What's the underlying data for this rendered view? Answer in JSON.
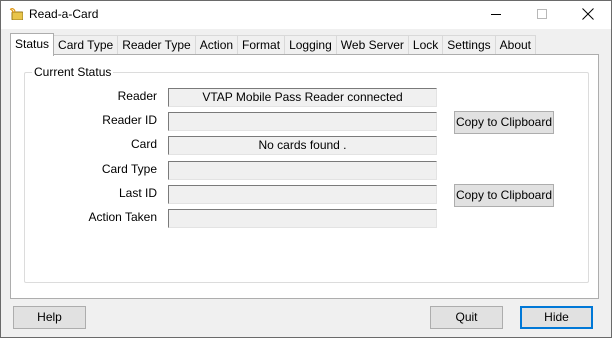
{
  "window": {
    "title": "Read-a-Card"
  },
  "tabs": [
    {
      "label": "Status",
      "active": true
    },
    {
      "label": "Card Type"
    },
    {
      "label": "Reader Type"
    },
    {
      "label": "Action"
    },
    {
      "label": "Format"
    },
    {
      "label": "Logging"
    },
    {
      "label": "Web Server"
    },
    {
      "label": "Lock"
    },
    {
      "label": "Settings"
    },
    {
      "label": "About"
    }
  ],
  "status": {
    "group_title": "Current Status",
    "fields": {
      "reader": {
        "label": "Reader",
        "value": "VTAP Mobile Pass Reader connected"
      },
      "reader_id": {
        "label": "Reader ID",
        "value": ""
      },
      "card": {
        "label": "Card",
        "value": "No cards found ."
      },
      "card_type": {
        "label": "Card Type",
        "value": ""
      },
      "last_id": {
        "label": "Last ID",
        "value": ""
      },
      "action_taken": {
        "label": "Action Taken",
        "value": ""
      }
    },
    "copy_reader_id_label": "Copy to Clipboard",
    "copy_last_id_label": "Copy to Clipboard"
  },
  "buttons": {
    "help": "Help",
    "quit": "Quit",
    "hide": "Hide"
  },
  "icons": {
    "app": "card-reader-icon",
    "minimize": "minimize-icon",
    "maximize": "maximize-icon",
    "close": "close-icon"
  },
  "colors": {
    "accent": "#0078d7",
    "window_bg": "#f0f0f0",
    "page_bg": "#ffffff"
  }
}
